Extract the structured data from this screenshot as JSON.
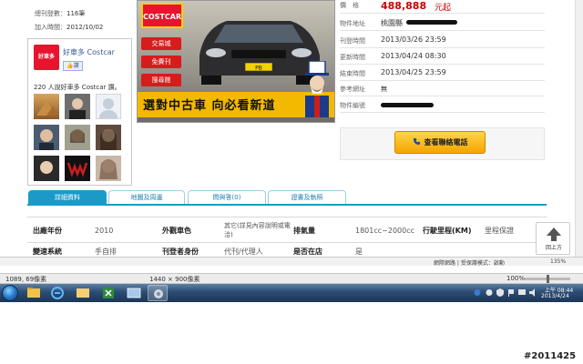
{
  "stats": {
    "trade_label": "總刊登數：",
    "trade_value": "116筆",
    "join_label": "加入時間：",
    "join_value": "2012/10/02"
  },
  "fanbox": {
    "logo_text": "好車多",
    "name": "好車多 Costcar",
    "like_label": "讚",
    "count_text": "220 人說好車多 Costcar 讚。"
  },
  "banner": {
    "brand": "COSTCAR",
    "side_buttons": [
      "交易城",
      "免費刊",
      "搜尋館"
    ],
    "plate": "PB",
    "slogan": "選對中古車 向必看新道"
  },
  "info": {
    "price_label": "價　格",
    "price_value": "488,888",
    "price_unit": "元起",
    "rows": [
      {
        "label": "物件地址",
        "value": "桃園縣"
      },
      {
        "label": "刊登時間",
        "value": "2013/03/26 23:59"
      },
      {
        "label": "更新時間",
        "value": "2013/04/24 08:30"
      },
      {
        "label": "結束時間",
        "value": "2013/04/25 23:59"
      },
      {
        "label": "參考網址",
        "value": "無"
      },
      {
        "label": "物件編號",
        "value": ""
      }
    ],
    "call_button": "查看聯絡電話"
  },
  "tabs": [
    "詳細資料",
    "地圖及周邊",
    "問與答(0)",
    "證書及執照"
  ],
  "details": {
    "row1": [
      {
        "key": "出廠年份",
        "value": "2010"
      },
      {
        "key": "外觀車色",
        "value": "其它(詳見內容說明或電洽)"
      },
      {
        "key": "排氣量",
        "value": "1801cc~2000cc"
      },
      {
        "key": "行駛里程(KM)",
        "value": "里程保證"
      }
    ],
    "row2": [
      {
        "key": "變速系統",
        "value": "手自排"
      },
      {
        "key": "刊登者身份",
        "value": "代刊/代理人"
      },
      {
        "key": "是否在店",
        "value": "是"
      }
    ]
  },
  "back_top": "回上方",
  "ie_status": {
    "left": "網際網路 | 受保護模式：啟動",
    "zoom": "135%"
  },
  "status_bar": {
    "coords": "1089, 69像素",
    "size": "1440 × 900像素",
    "zoom": "100%"
  },
  "taskbar": {
    "clock_ampm": "上午 08:44",
    "date": "2013/4/24"
  },
  "watermark": "#2011425"
}
